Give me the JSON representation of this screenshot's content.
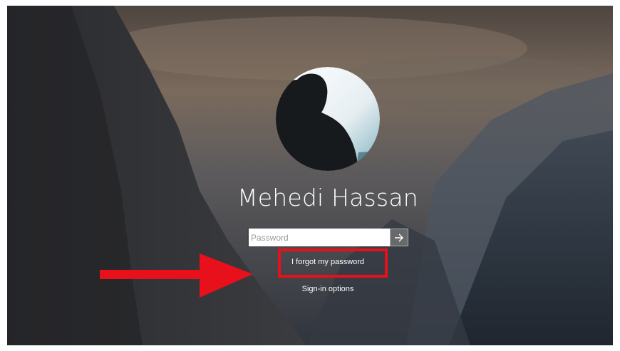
{
  "login": {
    "user_name": "Mehedi Hassan",
    "password_placeholder": "Password",
    "forgot_password_label": "I forgot my password",
    "sign_in_options_label": "Sign-in options"
  },
  "icons": {
    "submit": "arrow-right-icon",
    "annotation": "red-arrow-icon"
  },
  "colors": {
    "annotation_red": "#e8101a",
    "text": "#ffffff"
  }
}
